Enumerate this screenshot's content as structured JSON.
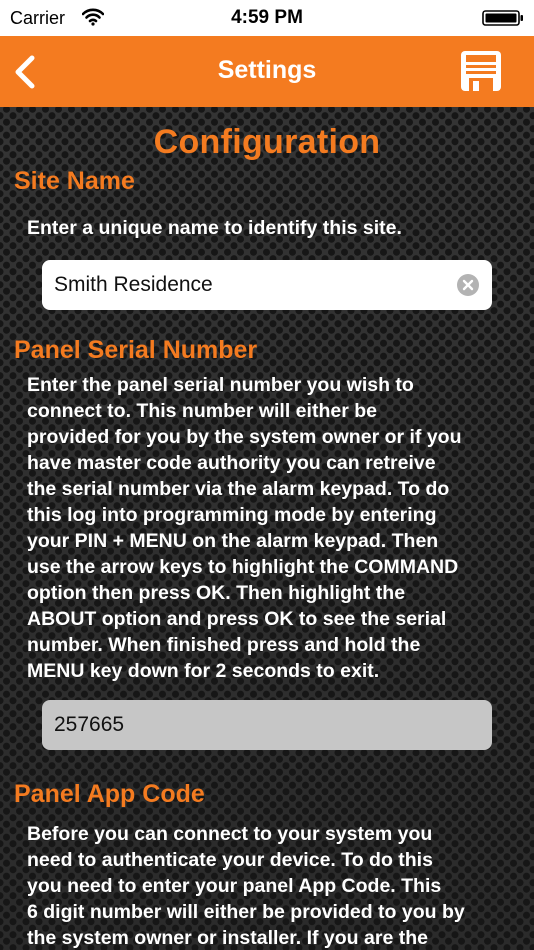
{
  "status_bar": {
    "carrier": "Carrier",
    "time": "4:59 PM"
  },
  "nav": {
    "title": "Settings",
    "back_icon": "chevron-left-icon",
    "save_icon": "floppy-disk-save-icon"
  },
  "page": {
    "title": "Configuration"
  },
  "site_name": {
    "heading": "Site Name",
    "description": "Enter a unique name to identify this site.",
    "value": "Smith Residence"
  },
  "panel_serial": {
    "heading": "Panel Serial Number",
    "description": "Enter the panel serial number you wish to\nconnect to.  This number will either be\nprovided for you by the system owner or if you\nhave master code authority you can retreive\nthe serial number via the alarm keypad.  To do\nthis log into programming mode by entering\nyour PIN + MENU on the alarm keypad.  Then\nuse the arrow keys to highlight the COMMAND\noption then press OK.  Then highlight the\nABOUT option and press OK to see the serial\nnumber.  When finished press and hold the\nMENU key down for 2 seconds to exit.",
    "value": "257665"
  },
  "panel_app_code": {
    "heading": "Panel App Code",
    "description": "Before you can connect to your system you\nneed to authenticate your device.  To do this\nyou need to enter your panel App Code.  This\n6 digit number will either be provided to you by\nthe system owner or installer.  If you are the"
  },
  "colors": {
    "accent": "#f47b20",
    "background": "#2d2d2d",
    "text": "#ffffff"
  }
}
